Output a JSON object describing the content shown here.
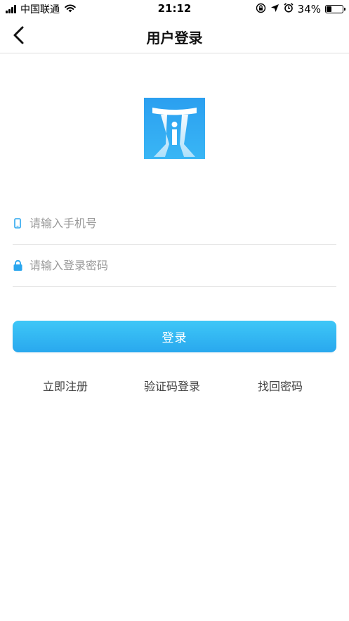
{
  "status_bar": {
    "carrier": "中国联通",
    "time": "21:12",
    "battery_text": "34%",
    "battery_level": 0.34
  },
  "nav": {
    "title": "用户登录"
  },
  "form": {
    "phone_placeholder": "请输入手机号",
    "password_placeholder": "请输入登录密码",
    "login_label": "登录"
  },
  "links": {
    "register": "立即注册",
    "sms_login": "验证码登录",
    "forgot_password": "找回密码"
  },
  "colors": {
    "accent": "#2fb3f2",
    "logo_bg": "#2aa5ee",
    "link_text": "#444444",
    "placeholder": "#9a9a9a"
  },
  "icons": [
    "signal-icon",
    "wifi-icon",
    "orientation-lock-icon",
    "location-icon",
    "alarm-icon",
    "battery-icon",
    "back-chevron-icon",
    "phone-icon",
    "lock-icon",
    "app-logo"
  ]
}
